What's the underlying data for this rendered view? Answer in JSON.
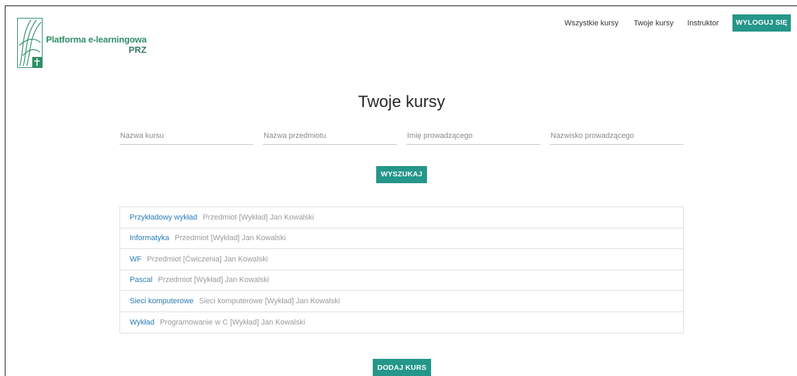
{
  "brand": {
    "line1": "Platforma e-learningowa",
    "line2": "PRZ"
  },
  "nav": {
    "all_courses": "Wszystkie kursy",
    "my_courses": "Twoje kursy",
    "instructor": "Instruktor",
    "logout": "WYLOGUJ SIĘ"
  },
  "page_title": "Twoje kursy",
  "search": {
    "course_name_placeholder": "Nazwa kursu",
    "subject_name_placeholder": "Nazwa przedmiotu",
    "instructor_first_name_placeholder": "Imię prowadzącego",
    "instructor_last_name_placeholder": "Nazwisko prowadzącego",
    "button": "WYSZUKAJ"
  },
  "courses": [
    {
      "name": "Przykładowy wykład",
      "info": "Przedmiot [Wykład] Jan Kowalski"
    },
    {
      "name": "Informatyka",
      "info": "Przedmiot [Wykład] Jan Kowalski"
    },
    {
      "name": "WF",
      "info": "Przedmiot [Ćwiczenia] Jan Kowalski"
    },
    {
      "name": "Pascal",
      "info": "Przedmiot [Wykład] Jan Kowalski"
    },
    {
      "name": "Sieci komputerowe",
      "info": "Sieci komputerowe [Wykład] Jan Kowalski"
    },
    {
      "name": "Wykład",
      "info": "Programowanie w C [Wykład] Jan Kowalski"
    }
  ],
  "add_course": "DODAJ KURS",
  "colors": {
    "accent": "#25968a",
    "brand_green": "#2f8f67",
    "link_blue": "#2a7ab8"
  }
}
